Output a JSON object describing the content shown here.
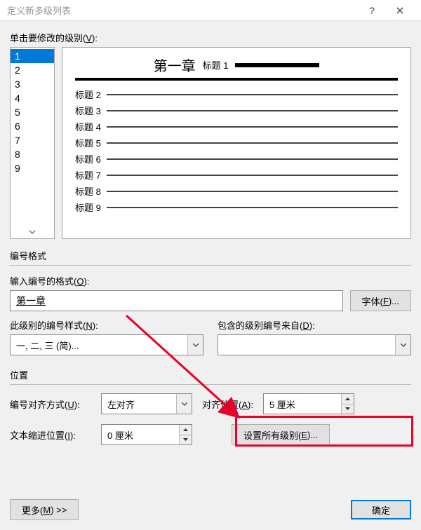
{
  "title": "定义新多级列表",
  "level_label_prefix": "单击要修改的级别(",
  "level_label_key": "V",
  "level_label_suffix": "):",
  "levels": [
    "1",
    "2",
    "3",
    "4",
    "5",
    "6",
    "7",
    "8",
    "9"
  ],
  "selected_level": "1",
  "preview": {
    "chapter": "第一章",
    "chapter_sub": "标题 1",
    "rows": [
      "标题 2",
      "标题 3",
      "标题 4",
      "标题 5",
      "标题 6",
      "标题 7",
      "标题 8",
      "标题 9"
    ]
  },
  "group_numfmt": "编号格式",
  "numfmt_label_prefix": "输入编号的格式(",
  "numfmt_label_key": "O",
  "numfmt_label_suffix": "):",
  "numfmt_value": "第一章",
  "font_btn_prefix": "字体(",
  "font_btn_key": "F",
  "font_btn_suffix": ")...",
  "numstyle_label_prefix": "此级别的编号样式(",
  "numstyle_label_key": "N",
  "numstyle_label_suffix": "):",
  "numstyle_value": "一, 二, 三 (简)...",
  "include_label_prefix": "包含的级别编号来自(",
  "include_label_key": "D",
  "include_label_suffix": "):",
  "include_value": "",
  "group_pos": "位置",
  "align_label_prefix": "编号对齐方式(",
  "align_label_key": "U",
  "align_label_suffix": "):",
  "align_value": "左对齐",
  "alignpos_label_prefix": "对齐位置(",
  "alignpos_label_key": "A",
  "alignpos_label_suffix": "):",
  "alignpos_value": "5 厘米",
  "indent_label_prefix": "文本缩进位置(",
  "indent_label_key": "I",
  "indent_label_suffix": "):",
  "indent_value": "0 厘米",
  "setall_btn_prefix": "设置所有级别(",
  "setall_btn_key": "E",
  "setall_btn_suffix": ")...",
  "more_btn_prefix": "更多(",
  "more_btn_key": "M",
  "more_btn_suffix": ") >>",
  "ok_btn": "确定"
}
